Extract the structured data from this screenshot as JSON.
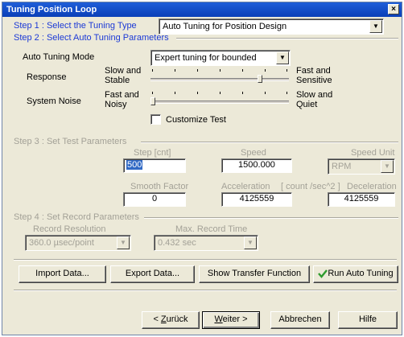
{
  "window": {
    "title": "Tuning Position Loop",
    "close_glyph": "×"
  },
  "step1": {
    "label": "Step 1 : Select the  Tuning Type",
    "tuning_type": "Auto Tuning for Position Design"
  },
  "step2": {
    "label": "Step 2 :  Select Auto Tuning Parameters",
    "mode_label": "Auto Tuning Mode",
    "mode_value": "Expert tuning for bounded",
    "response_label": "Response",
    "response_left": [
      "Slow and",
      "Stable"
    ],
    "response_right": [
      "Fast and",
      "Sensitive"
    ],
    "response_level": 0.8,
    "noise_label": "System Noise",
    "noise_left": [
      "Fast and",
      "Noisy"
    ],
    "noise_right": [
      "Slow and",
      "Quiet"
    ],
    "noise_level": 0.0,
    "customize_label": "Customize Test",
    "customize_checked": false
  },
  "step3": {
    "label": "Step 3 : Set Test  Parameters",
    "step_label": "Step [cnt]",
    "step_value": "500",
    "speed_label": "Speed",
    "speed_value": "1500.000",
    "speed_unit_label": "Speed Unit",
    "speed_unit_value": "RPM",
    "smooth_label": "Smooth Factor",
    "smooth_value": "0",
    "accel_label": "Acceleration",
    "accel_unit": "[ count /sec^2 ]",
    "decel_label": "Deceleration",
    "accel_value": "4125559",
    "decel_value": "4125559"
  },
  "step4": {
    "label": "Step 4 : Set Record Parameters",
    "resolution_label": "Record Resolution",
    "resolution_value": "360.0 µsec/point",
    "max_time_label": "Max. Record Time",
    "max_time_value": "0.432 sec"
  },
  "actions": {
    "import": "Import Data...",
    "export": "Export Data...",
    "transfer": "Show Transfer Function",
    "run": "Run Auto Tuning"
  },
  "nav": {
    "back_prefix": "< ",
    "back_key": "Z",
    "back_rest": "urück",
    "next_key": "W",
    "next_rest": "eiter >",
    "cancel": "Abbrechen",
    "help": "Hilfe"
  },
  "colors": {
    "step_blue": "#1b39d6",
    "disabled_gray": "#a3a197",
    "run_check_green": "#2e9b2e"
  }
}
